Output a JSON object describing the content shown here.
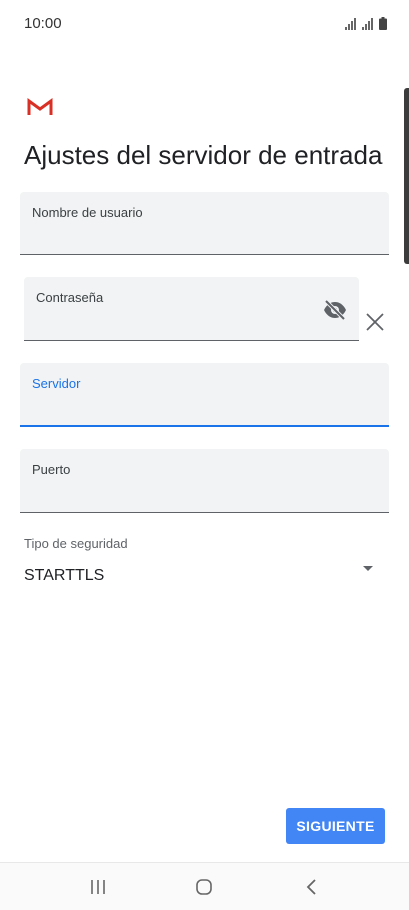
{
  "status_bar": {
    "time": "10:00",
    "icons": [
      "signal-icon",
      "signal-icon",
      "battery-icon"
    ]
  },
  "header": {
    "logo": "gmail-logo-icon",
    "title": "Ajustes del servidor de entrada"
  },
  "form": {
    "username": {
      "label": "Nombre de usuario",
      "value": ""
    },
    "password": {
      "label": "Contraseña",
      "value": "",
      "visibility_icon": "eye-off-icon",
      "clear_icon": "close-icon"
    },
    "server": {
      "label": "Servidor",
      "value": "",
      "focused": true
    },
    "port": {
      "label": "Puerto",
      "value": ""
    },
    "security": {
      "label": "Tipo de seguridad",
      "value": "STARTTLS"
    }
  },
  "actions": {
    "next_label": "SIGUIENTE"
  },
  "nav_bar": {
    "buttons": [
      "recent-apps-icon",
      "home-icon",
      "back-icon"
    ]
  },
  "colors": {
    "accent": "#1a73e8",
    "button": "#4285f4",
    "field_bg": "#f1f3f4"
  }
}
